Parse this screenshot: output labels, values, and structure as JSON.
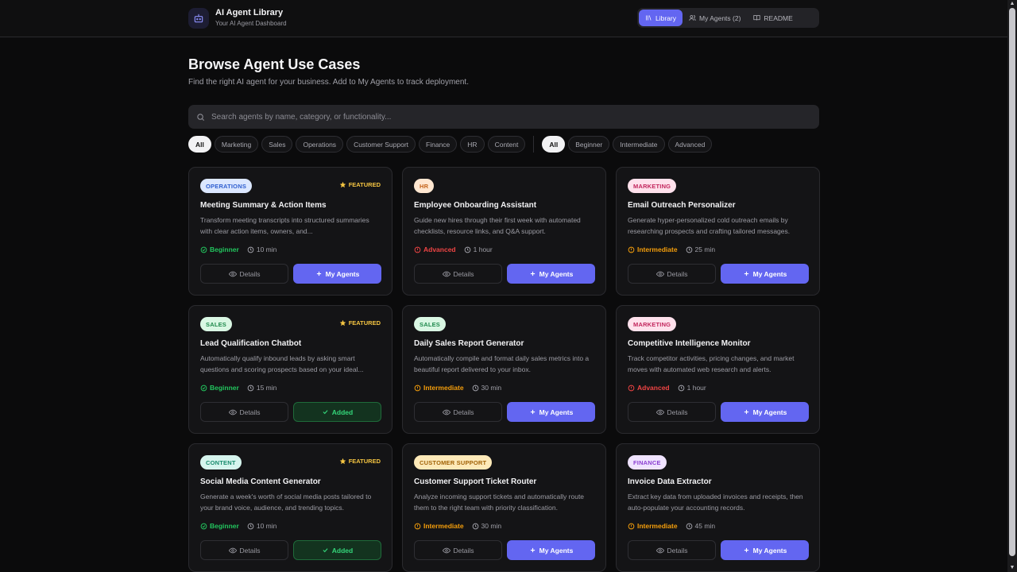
{
  "header": {
    "title": "AI Agent Library",
    "subtitle": "Your AI Agent Dashboard",
    "nav": [
      {
        "label": "Library",
        "icon": "library-icon"
      },
      {
        "label": "My Agents (2)",
        "icon": "users-icon"
      },
      {
        "label": "README",
        "icon": "book-icon"
      }
    ]
  },
  "page": {
    "title": "Browse Agent Use Cases",
    "subtitle": "Find the right AI agent for your business. Add to My Agents to track deployment."
  },
  "search": {
    "placeholder": "Search agents by name, category, or functionality..."
  },
  "filters": {
    "categories": [
      "All",
      "Marketing",
      "Sales",
      "Operations",
      "Customer Support",
      "Finance",
      "HR",
      "Content"
    ],
    "levels": [
      "All",
      "Beginner",
      "Intermediate",
      "Advanced"
    ]
  },
  "labels": {
    "details": "Details",
    "add": "My Agents",
    "added": "Added",
    "featured": "FEATURED"
  },
  "colors": {
    "accent": "#6366f1",
    "beginner": "#22c55e",
    "intermediate": "#f59e0b",
    "advanced": "#ef4444",
    "featured": "#f5c542"
  },
  "cards": [
    {
      "category": "OPERATIONS",
      "featured": true,
      "title": "Meeting Summary & Action Items",
      "desc": "Transform meeting transcripts into structured summaries with clear action items, owners, and...",
      "level": "Beginner",
      "time": "10 min",
      "added": false
    },
    {
      "category": "HR",
      "featured": false,
      "title": "Employee Onboarding Assistant",
      "desc": "Guide new hires through their first week with automated checklists, resource links, and Q&A support.",
      "level": "Advanced",
      "time": "1 hour",
      "added": false
    },
    {
      "category": "MARKETING",
      "featured": false,
      "title": "Email Outreach Personalizer",
      "desc": "Generate hyper-personalized cold outreach emails by researching prospects and crafting tailored messages.",
      "level": "Intermediate",
      "time": "25 min",
      "added": false
    },
    {
      "category": "SALES",
      "featured": true,
      "title": "Lead Qualification Chatbot",
      "desc": "Automatically qualify inbound leads by asking smart questions and scoring prospects based on your ideal...",
      "level": "Beginner",
      "time": "15 min",
      "added": true
    },
    {
      "category": "SALES",
      "featured": false,
      "title": "Daily Sales Report Generator",
      "desc": "Automatically compile and format daily sales metrics into a beautiful report delivered to your inbox.",
      "level": "Intermediate",
      "time": "30 min",
      "added": false
    },
    {
      "category": "MARKETING",
      "featured": false,
      "title": "Competitive Intelligence Monitor",
      "desc": "Track competitor activities, pricing changes, and market moves with automated web research and alerts.",
      "level": "Advanced",
      "time": "1 hour",
      "added": false
    },
    {
      "category": "CONTENT",
      "featured": true,
      "title": "Social Media Content Generator",
      "desc": "Generate a week's worth of social media posts tailored to your brand voice, audience, and trending topics.",
      "level": "Beginner",
      "time": "10 min",
      "added": true
    },
    {
      "category": "CUSTOMER SUPPORT",
      "featured": false,
      "title": "Customer Support Ticket Router",
      "desc": "Analyze incoming support tickets and automatically route them to the right team with priority classification.",
      "level": "Intermediate",
      "time": "30 min",
      "added": false
    },
    {
      "category": "FINANCE",
      "featured": false,
      "title": "Invoice Data Extractor",
      "desc": "Extract key data from uploaded invoices and receipts, then auto-populate your accounting records.",
      "level": "Intermediate",
      "time": "45 min",
      "added": false
    }
  ]
}
